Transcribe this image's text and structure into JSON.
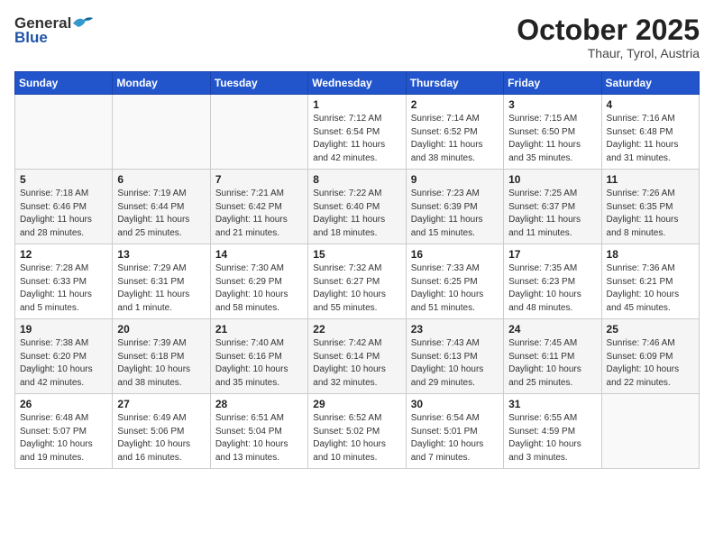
{
  "logo": {
    "general": "General",
    "blue": "Blue"
  },
  "header": {
    "month": "October 2025",
    "location": "Thaur, Tyrol, Austria"
  },
  "weekdays": [
    "Sunday",
    "Monday",
    "Tuesday",
    "Wednesday",
    "Thursday",
    "Friday",
    "Saturday"
  ],
  "weeks": [
    [
      {
        "day": "",
        "sunrise": "",
        "sunset": "",
        "daylight": ""
      },
      {
        "day": "",
        "sunrise": "",
        "sunset": "",
        "daylight": ""
      },
      {
        "day": "",
        "sunrise": "",
        "sunset": "",
        "daylight": ""
      },
      {
        "day": "1",
        "sunrise": "Sunrise: 7:12 AM",
        "sunset": "Sunset: 6:54 PM",
        "daylight": "Daylight: 11 hours and 42 minutes."
      },
      {
        "day": "2",
        "sunrise": "Sunrise: 7:14 AM",
        "sunset": "Sunset: 6:52 PM",
        "daylight": "Daylight: 11 hours and 38 minutes."
      },
      {
        "day": "3",
        "sunrise": "Sunrise: 7:15 AM",
        "sunset": "Sunset: 6:50 PM",
        "daylight": "Daylight: 11 hours and 35 minutes."
      },
      {
        "day": "4",
        "sunrise": "Sunrise: 7:16 AM",
        "sunset": "Sunset: 6:48 PM",
        "daylight": "Daylight: 11 hours and 31 minutes."
      }
    ],
    [
      {
        "day": "5",
        "sunrise": "Sunrise: 7:18 AM",
        "sunset": "Sunset: 6:46 PM",
        "daylight": "Daylight: 11 hours and 28 minutes."
      },
      {
        "day": "6",
        "sunrise": "Sunrise: 7:19 AM",
        "sunset": "Sunset: 6:44 PM",
        "daylight": "Daylight: 11 hours and 25 minutes."
      },
      {
        "day": "7",
        "sunrise": "Sunrise: 7:21 AM",
        "sunset": "Sunset: 6:42 PM",
        "daylight": "Daylight: 11 hours and 21 minutes."
      },
      {
        "day": "8",
        "sunrise": "Sunrise: 7:22 AM",
        "sunset": "Sunset: 6:40 PM",
        "daylight": "Daylight: 11 hours and 18 minutes."
      },
      {
        "day": "9",
        "sunrise": "Sunrise: 7:23 AM",
        "sunset": "Sunset: 6:39 PM",
        "daylight": "Daylight: 11 hours and 15 minutes."
      },
      {
        "day": "10",
        "sunrise": "Sunrise: 7:25 AM",
        "sunset": "Sunset: 6:37 PM",
        "daylight": "Daylight: 11 hours and 11 minutes."
      },
      {
        "day": "11",
        "sunrise": "Sunrise: 7:26 AM",
        "sunset": "Sunset: 6:35 PM",
        "daylight": "Daylight: 11 hours and 8 minutes."
      }
    ],
    [
      {
        "day": "12",
        "sunrise": "Sunrise: 7:28 AM",
        "sunset": "Sunset: 6:33 PM",
        "daylight": "Daylight: 11 hours and 5 minutes."
      },
      {
        "day": "13",
        "sunrise": "Sunrise: 7:29 AM",
        "sunset": "Sunset: 6:31 PM",
        "daylight": "Daylight: 11 hours and 1 minute."
      },
      {
        "day": "14",
        "sunrise": "Sunrise: 7:30 AM",
        "sunset": "Sunset: 6:29 PM",
        "daylight": "Daylight: 10 hours and 58 minutes."
      },
      {
        "day": "15",
        "sunrise": "Sunrise: 7:32 AM",
        "sunset": "Sunset: 6:27 PM",
        "daylight": "Daylight: 10 hours and 55 minutes."
      },
      {
        "day": "16",
        "sunrise": "Sunrise: 7:33 AM",
        "sunset": "Sunset: 6:25 PM",
        "daylight": "Daylight: 10 hours and 51 minutes."
      },
      {
        "day": "17",
        "sunrise": "Sunrise: 7:35 AM",
        "sunset": "Sunset: 6:23 PM",
        "daylight": "Daylight: 10 hours and 48 minutes."
      },
      {
        "day": "18",
        "sunrise": "Sunrise: 7:36 AM",
        "sunset": "Sunset: 6:21 PM",
        "daylight": "Daylight: 10 hours and 45 minutes."
      }
    ],
    [
      {
        "day": "19",
        "sunrise": "Sunrise: 7:38 AM",
        "sunset": "Sunset: 6:20 PM",
        "daylight": "Daylight: 10 hours and 42 minutes."
      },
      {
        "day": "20",
        "sunrise": "Sunrise: 7:39 AM",
        "sunset": "Sunset: 6:18 PM",
        "daylight": "Daylight: 10 hours and 38 minutes."
      },
      {
        "day": "21",
        "sunrise": "Sunrise: 7:40 AM",
        "sunset": "Sunset: 6:16 PM",
        "daylight": "Daylight: 10 hours and 35 minutes."
      },
      {
        "day": "22",
        "sunrise": "Sunrise: 7:42 AM",
        "sunset": "Sunset: 6:14 PM",
        "daylight": "Daylight: 10 hours and 32 minutes."
      },
      {
        "day": "23",
        "sunrise": "Sunrise: 7:43 AM",
        "sunset": "Sunset: 6:13 PM",
        "daylight": "Daylight: 10 hours and 29 minutes."
      },
      {
        "day": "24",
        "sunrise": "Sunrise: 7:45 AM",
        "sunset": "Sunset: 6:11 PM",
        "daylight": "Daylight: 10 hours and 25 minutes."
      },
      {
        "day": "25",
        "sunrise": "Sunrise: 7:46 AM",
        "sunset": "Sunset: 6:09 PM",
        "daylight": "Daylight: 10 hours and 22 minutes."
      }
    ],
    [
      {
        "day": "26",
        "sunrise": "Sunrise: 6:48 AM",
        "sunset": "Sunset: 5:07 PM",
        "daylight": "Daylight: 10 hours and 19 minutes."
      },
      {
        "day": "27",
        "sunrise": "Sunrise: 6:49 AM",
        "sunset": "Sunset: 5:06 PM",
        "daylight": "Daylight: 10 hours and 16 minutes."
      },
      {
        "day": "28",
        "sunrise": "Sunrise: 6:51 AM",
        "sunset": "Sunset: 5:04 PM",
        "daylight": "Daylight: 10 hours and 13 minutes."
      },
      {
        "day": "29",
        "sunrise": "Sunrise: 6:52 AM",
        "sunset": "Sunset: 5:02 PM",
        "daylight": "Daylight: 10 hours and 10 minutes."
      },
      {
        "day": "30",
        "sunrise": "Sunrise: 6:54 AM",
        "sunset": "Sunset: 5:01 PM",
        "daylight": "Daylight: 10 hours and 7 minutes."
      },
      {
        "day": "31",
        "sunrise": "Sunrise: 6:55 AM",
        "sunset": "Sunset: 4:59 PM",
        "daylight": "Daylight: 10 hours and 3 minutes."
      },
      {
        "day": "",
        "sunrise": "",
        "sunset": "",
        "daylight": ""
      }
    ]
  ]
}
